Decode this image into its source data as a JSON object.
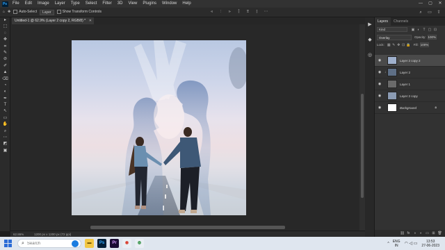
{
  "app": {
    "logo": "Ps"
  },
  "menu": [
    "File",
    "Edit",
    "Image",
    "Layer",
    "Type",
    "Select",
    "Filter",
    "3D",
    "View",
    "Plugins",
    "Window",
    "Help"
  ],
  "window_controls": {
    "minimize": "—",
    "maximize": "▢",
    "close": "✕"
  },
  "options_bar": {
    "home_icon": "⌂",
    "move_icon": "✥",
    "auto_select_label": "Auto-Select",
    "auto_select_target": "Layer",
    "show_transform_label": "Show Transform Controls",
    "align_icons": [
      "⫷",
      "⫶",
      "⫸",
      "⫿",
      "⩨",
      "⫾",
      "⋯"
    ],
    "right_icons": [
      "⌕",
      "▭",
      "⇪"
    ]
  },
  "tools": [
    "▸",
    "⬚",
    "◌",
    "✥",
    "⌗",
    "✎",
    "⊘",
    "✐",
    "▲",
    "⌫",
    "◔",
    "◐",
    "✒",
    "T",
    "↖",
    "▭",
    "✋",
    "⌕",
    "⋯",
    "◩",
    "▣"
  ],
  "document_tab": {
    "title": "Untitled-1 @ 62.9% (Layer 2 copy 2, RGB/8) *",
    "close": "✕"
  },
  "status_bar": {
    "zoom": "62.86%",
    "size": "1200 px x 1200 px (72 ppi)"
  },
  "side_icons": [
    "▶",
    "◆",
    "◎"
  ],
  "layers_panel": {
    "tabs": [
      "Layers",
      "Channels"
    ],
    "kind_filter": "Kind",
    "filter_icons": [
      "▣",
      "◐",
      "T",
      "▢",
      "⊡"
    ],
    "blend_mode": "Overlay",
    "opacity_label": "Opacity:",
    "opacity_value": "100%",
    "lock_label": "Lock:",
    "lock_icons": [
      "▦",
      "✎",
      "✥",
      "⊡",
      "🔒"
    ],
    "fill_label": "Fill:",
    "fill_value": "100%",
    "layers": [
      {
        "name": "Layer 2 copy 2",
        "selected": true,
        "clipped": false,
        "italic": false,
        "thumb": "#9fb0cc"
      },
      {
        "name": "Layer 2",
        "selected": false,
        "clipped": true,
        "italic": false,
        "thumb": "#5e6f86"
      },
      {
        "name": "Layer 1",
        "selected": false,
        "clipped": false,
        "italic": false,
        "thumb": "#6a6a6a"
      },
      {
        "name": "Layer 2 copy",
        "selected": false,
        "clipped": false,
        "italic": false,
        "thumb": "#8b9bb3"
      },
      {
        "name": "Background",
        "selected": false,
        "clipped": false,
        "italic": true,
        "thumb": "#ffffff",
        "locked": true
      }
    ],
    "bottom_icons": [
      "⛓",
      "fx",
      "◑",
      "◐",
      "▭",
      "⊞",
      "🗑"
    ]
  },
  "taskbar": {
    "search_placeholder": "Search",
    "apps": [
      {
        "name": "file-explorer",
        "glyph": "▬",
        "bg": "#f2c744",
        "fg": "#6b4e00"
      },
      {
        "name": "photoshop",
        "glyph": "Ps",
        "bg": "#001e36",
        "fg": "#31a8ff"
      },
      {
        "name": "premiere",
        "glyph": "Pr",
        "bg": "#1a0b33",
        "fg": "#d59cff"
      },
      {
        "name": "app-red",
        "glyph": "◉",
        "bg": "#e9eef4",
        "fg": "#d83a2a"
      },
      {
        "name": "chrome",
        "glyph": "◍",
        "bg": "#e9eef4",
        "fg": "#2a8d3c"
      }
    ],
    "chevron": "^",
    "lang_top": "ENG",
    "lang_bottom": "IN",
    "sys_icons": "◠ ◁ ▭",
    "time": "13:53",
    "date": "27-06-2023"
  },
  "colors": {
    "accent": "#31a8ff",
    "panel": "#323232",
    "canvas": "#282828"
  }
}
